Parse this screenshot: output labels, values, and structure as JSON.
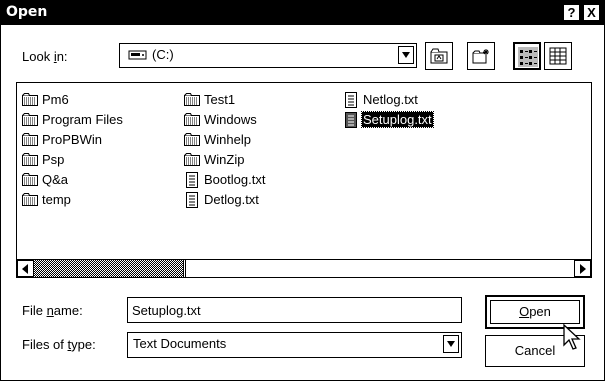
{
  "window": {
    "title": "Open",
    "help_glyph": "?",
    "close_glyph": "X"
  },
  "look_in": {
    "label_prefix": "Look ",
    "label_accel": "i",
    "label_suffix": "n:",
    "drive_icon": "hard-drive-icon",
    "value": "(C:)"
  },
  "toolbar": {
    "up_folder_icon": "up-one-level-icon",
    "new_folder_icon": "create-new-folder-icon",
    "list_view_icon": "list-view-icon",
    "details_view_icon": "details-view-icon"
  },
  "files": [
    {
      "name": "Pm6",
      "icon": "folder-icon",
      "selected": false
    },
    {
      "name": "Program Files",
      "icon": "folder-icon",
      "selected": false
    },
    {
      "name": "ProPBWin",
      "icon": "folder-icon",
      "selected": false
    },
    {
      "name": "Psp",
      "icon": "folder-icon",
      "selected": false
    },
    {
      "name": "Q&a",
      "icon": "folder-icon",
      "selected": false
    },
    {
      "name": "temp",
      "icon": "folder-icon",
      "selected": false
    },
    {
      "name": "Test1",
      "icon": "folder-icon",
      "selected": false
    },
    {
      "name": "Windows",
      "icon": "folder-icon",
      "selected": false
    },
    {
      "name": "Winhelp",
      "icon": "folder-icon",
      "selected": false
    },
    {
      "name": "WinZip",
      "icon": "folder-icon",
      "selected": false
    },
    {
      "name": "Bootlog.txt",
      "icon": "text-file-icon",
      "selected": false
    },
    {
      "name": "Detlog.txt",
      "icon": "text-file-icon",
      "selected": false
    },
    {
      "name": "Netlog.txt",
      "icon": "text-file-icon",
      "selected": false
    },
    {
      "name": "Setuplog.txt",
      "icon": "text-file-icon",
      "selected": true
    }
  ],
  "file_name": {
    "label_prefix": "File ",
    "label_accel": "n",
    "label_suffix": "ame:",
    "value": "Setuplog.txt"
  },
  "file_type": {
    "label_prefix": "Files of ",
    "label_accel": "t",
    "label_suffix": "ype:",
    "value": "Text Documents"
  },
  "buttons": {
    "open_accel": "O",
    "open_rest": "pen",
    "cancel": "Cancel"
  }
}
